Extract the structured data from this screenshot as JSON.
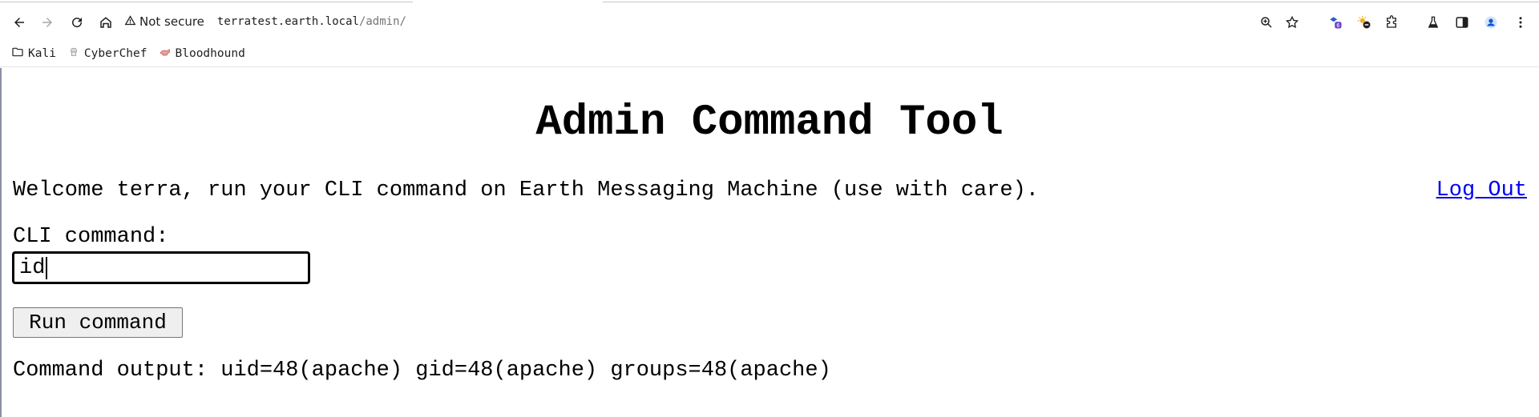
{
  "browser": {
    "security_label": "Not secure",
    "url_host": "terratest.earth.local",
    "url_path": "/admin/",
    "extension_badge": "6",
    "bookmarks": [
      {
        "label": "Kali",
        "icon": "folder-icon"
      },
      {
        "label": "CyberChef",
        "icon": "cyberchef-icon"
      },
      {
        "label": "Bloodhound",
        "icon": "bloodhound-icon"
      }
    ]
  },
  "page": {
    "title": "Admin Command Tool",
    "welcome_text": "Welcome terra, run your CLI command on Earth Messaging Machine (use with care).",
    "logout_label": "Log Out",
    "cli_label": "CLI command:",
    "cli_value": "id",
    "run_button_label": "Run command",
    "output_text": "Command output: uid=48(apache) gid=48(apache) groups=48(apache)"
  },
  "colors": {
    "link": "#0000ee",
    "button_bg": "#efefef"
  }
}
